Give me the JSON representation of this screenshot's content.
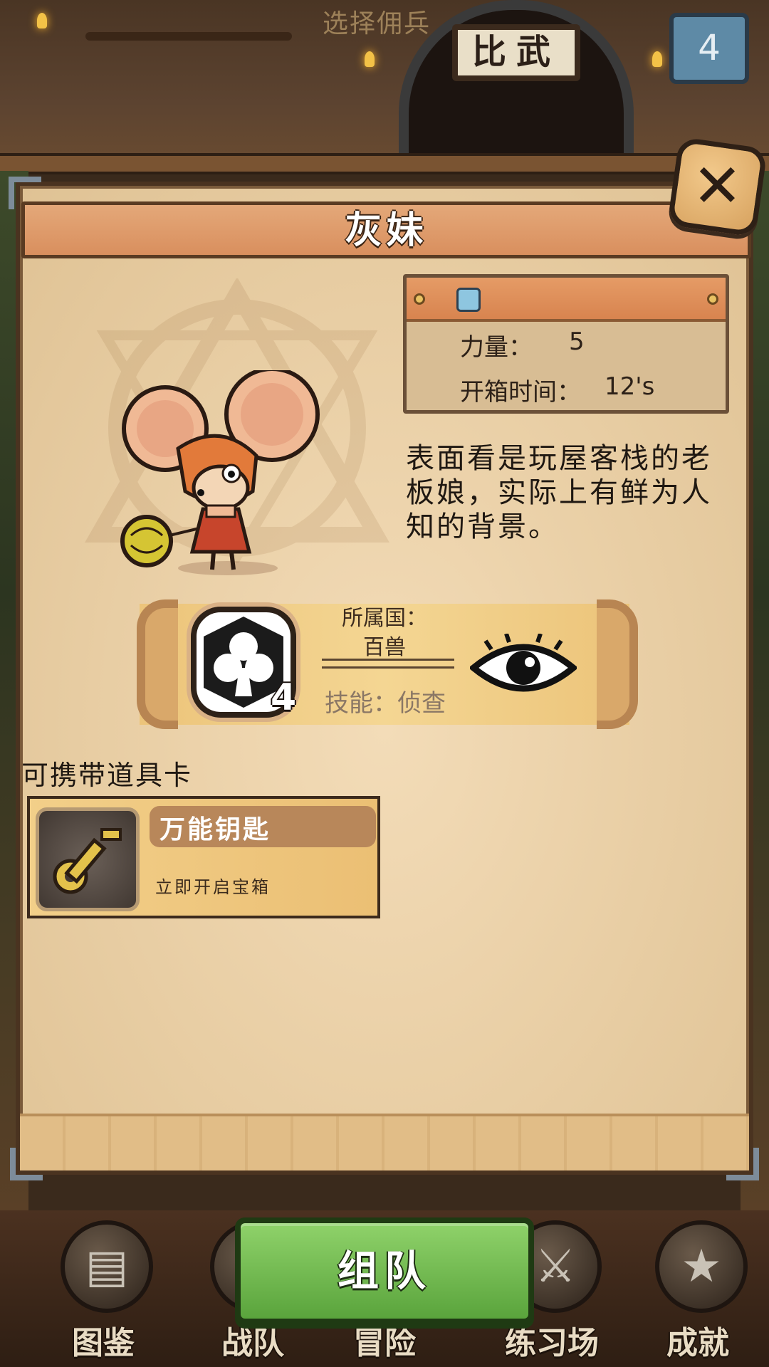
{
  "screen_title": "选择佣兵",
  "arena_sign": "比武",
  "round_counter": "4",
  "character": {
    "name": "灰妹",
    "description": "表面看是玩屋客栈的老板娘，实际上有鲜为人知的背景。",
    "stats": [
      {
        "label": "力量：",
        "value": "5"
      },
      {
        "label": "开箱时间：",
        "value": "12's"
      }
    ]
  },
  "faction": {
    "nation_label": "所属国：",
    "nation_value": "百兽",
    "level": "4",
    "skill_text": "技能：侦查",
    "faction_icon": "club-icon",
    "skill_icon": "eye-icon"
  },
  "carry_items": {
    "title": "可携带道具卡",
    "items": [
      {
        "name": "万能钥匙",
        "desc": "立即开启宝箱",
        "icon": "key-icon"
      }
    ]
  },
  "team_button": "组队",
  "bottom_nav": [
    {
      "label": "图鉴",
      "icon": "book-icon"
    },
    {
      "label": "战队",
      "icon": "squad-icon"
    },
    {
      "label": "冒险",
      "icon": "adventure-icon"
    },
    {
      "label": "练习场",
      "icon": "weapon-icon"
    },
    {
      "label": "成就",
      "icon": "star-icon"
    }
  ],
  "colors": {
    "header": "#d98f5e",
    "panel": "#ead0a7",
    "team_button": "#5aa43c",
    "banner": "#f4d693"
  }
}
